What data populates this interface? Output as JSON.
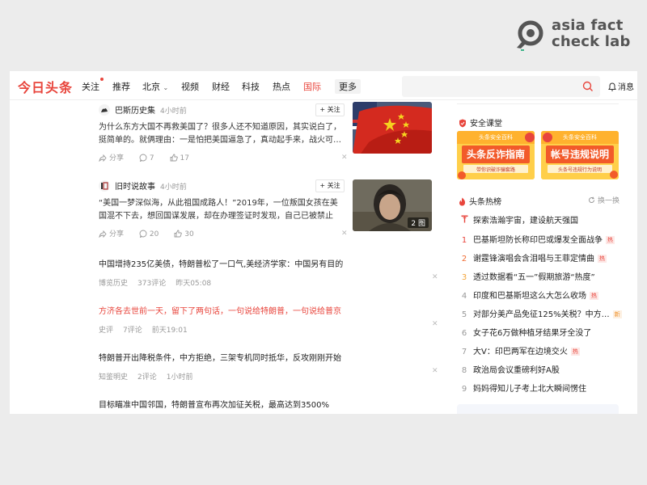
{
  "watermark": {
    "line1": "asia fact",
    "line2": "check lab"
  },
  "nav": {
    "logo": "今日头条",
    "items": [
      "关注",
      "推荐",
      "北京",
      "视频",
      "财经",
      "科技",
      "热点",
      "国际",
      "更多"
    ],
    "active": "国际",
    "messages": "消息",
    "colors": {
      "accent": "#e8453c"
    }
  },
  "feed": {
    "cards": [
      {
        "source": "巴斯历史集",
        "time": "4小时前",
        "follow": "+ 关注",
        "excerpt": "为什么东方大国不再救美国了？很多人还不知道原因，其实说白了，挺简单的。就俩理由：一是怕把美国逼急了，真动起手来，战火可…",
        "share": "分享",
        "comments": "7",
        "likes": "17"
      },
      {
        "source": "旧时说故事",
        "time": "4小时前",
        "follow": "+ 关注",
        "excerpt": "“美国一梦深似海，从此祖国成路人！”2019年，一位叛国女孩在美国混不下去，想回国谋发展，却在办理签证时发现，自己已被禁止入…",
        "share": "分享",
        "comments": "20",
        "likes": "30",
        "pics": "2 图"
      }
    ],
    "rows": [
      {
        "title": "中国增持235亿美债，特朗普松了一口气,美经济学家：中国另有目的",
        "source": "博览历史",
        "comments": "373评论",
        "time": "昨天05:08",
        "red": false
      },
      {
        "title": "方济各去世前一天，留下了两句话，一句说给特朗普，一句说给普京",
        "source": "史评",
        "comments": "7评论",
        "time": "前天19:01",
        "red": true
      },
      {
        "title": "特朗普开出降税条件，中方拒绝，三架专机同时抵华，反攻刚刚开始",
        "source": "知鉴明史",
        "comments": "2评论",
        "time": "1小时前",
        "red": false
      },
      {
        "title": "目标瞄准中国邻国，特朗普宣布再次加征关税，最高达到3500%",
        "source": "",
        "comments": "",
        "time": "",
        "red": false
      }
    ]
  },
  "sidebar": {
    "safety_title": "安全课堂",
    "banners": [
      {
        "top": "头条安全百科",
        "title": "头条反诈指南",
        "sub": "带你识破诈骗套路"
      },
      {
        "top": "头条安全百科",
        "title": "帐号违规说明",
        "sub": "头条号违规行为说明"
      }
    ],
    "hot_title": "头条热榜",
    "refresh": "换一换",
    "hot": [
      {
        "rank": "",
        "text": "探索浩瀚宇宙，建设航天强国",
        "tag": ""
      },
      {
        "rank": "1",
        "text": "巴基斯坦防长称印巴或爆发全面战争",
        "tag": "热"
      },
      {
        "rank": "2",
        "text": "谢霆锋演唱会含泪唱与王菲定情曲",
        "tag": "热"
      },
      {
        "rank": "3",
        "text": "透过数据看“五一”假期旅游“热度”",
        "tag": ""
      },
      {
        "rank": "4",
        "text": "印度和巴基斯坦这么大怎么收场",
        "tag": "热"
      },
      {
        "rank": "5",
        "text": "对部分美产品免征125%关税？中方…",
        "tag": "新"
      },
      {
        "rank": "6",
        "text": "女子花6万做种植牙结果牙全没了",
        "tag": ""
      },
      {
        "rank": "7",
        "text": "大V：印巴两军在边境交火",
        "tag": "热"
      },
      {
        "rank": "8",
        "text": "政治局会议重磅利好A股",
        "tag": ""
      },
      {
        "rank": "9",
        "text": "妈妈得知儿子考上北大瞬间愣住",
        "tag": ""
      }
    ]
  }
}
